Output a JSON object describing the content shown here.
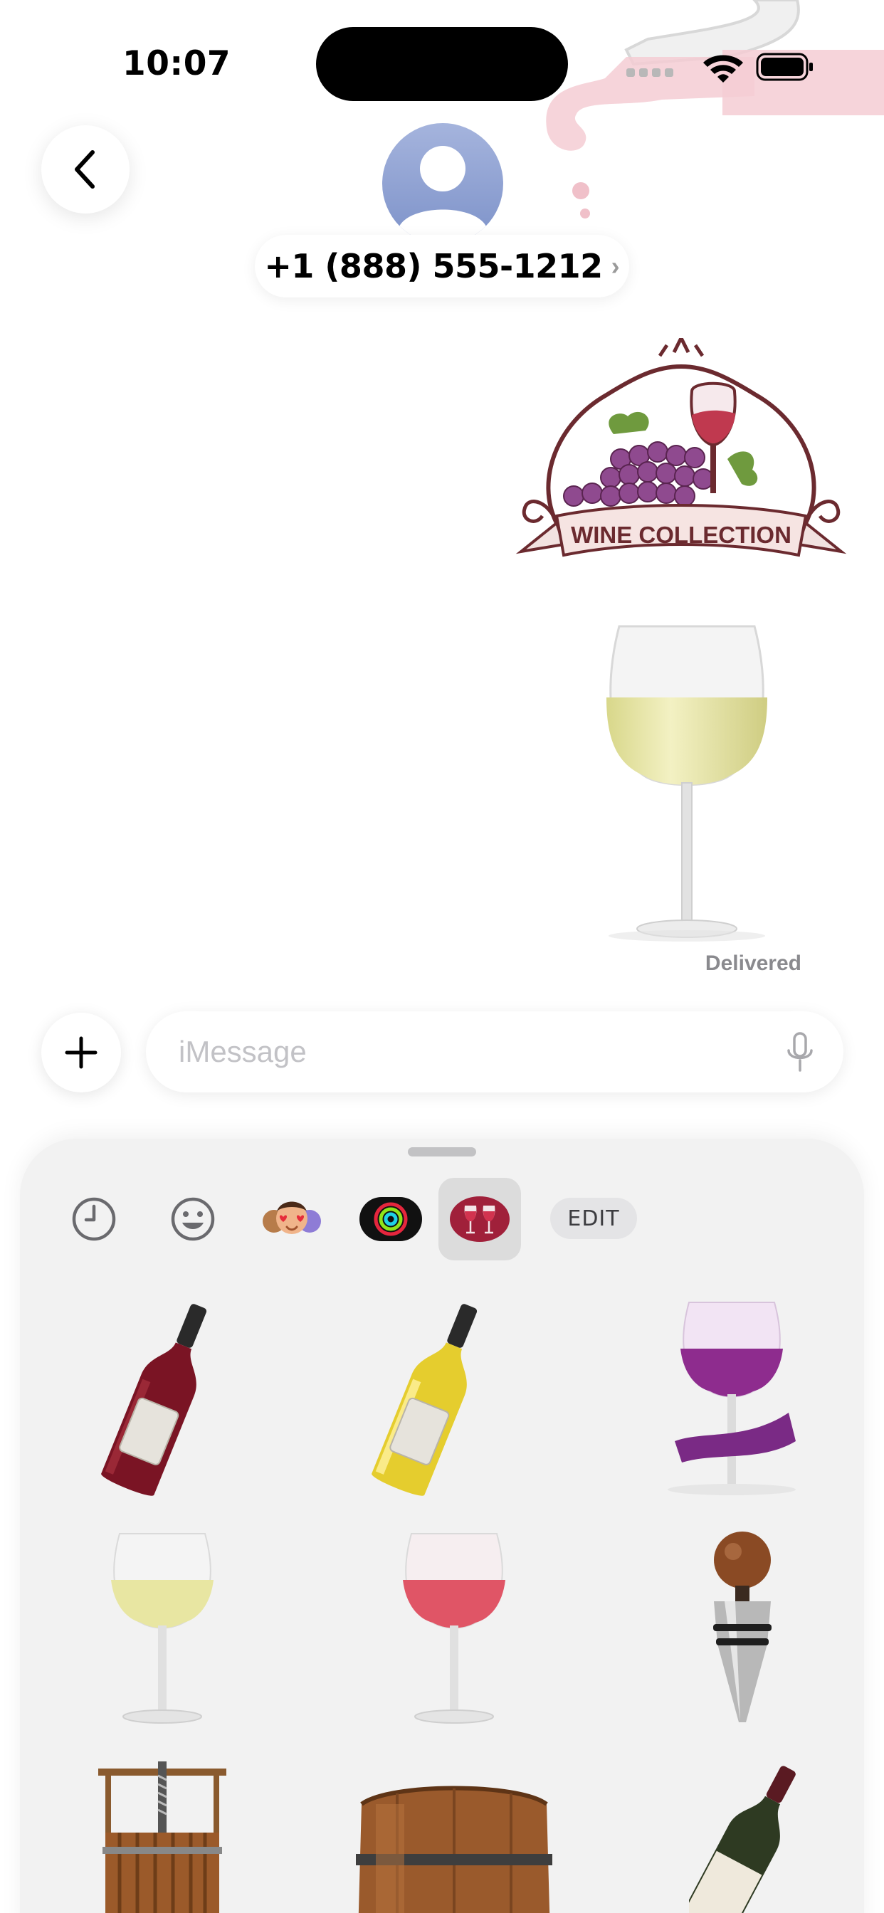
{
  "status_bar": {
    "time": "10:07"
  },
  "header": {
    "back_icon": "chevron-left-icon",
    "avatar_icon": "person-icon",
    "contact_number": "+1 (888) 555-1212",
    "contact_chevron": "›"
  },
  "conversation": {
    "stickers": [
      {
        "name": "wine-collection-logo-sticker",
        "text": "WINE COLLECTION"
      },
      {
        "name": "white-wine-glass-sticker"
      }
    ],
    "delivery_status": "Delivered"
  },
  "composer": {
    "placeholder": "iMessage",
    "plus_icon": "plus-icon",
    "mic_icon": "microphone-icon"
  },
  "drawer": {
    "tabs": [
      {
        "name": "recents",
        "icon": "clock-icon"
      },
      {
        "name": "emoji",
        "icon": "smiley-icon"
      },
      {
        "name": "memoji",
        "icon": "memoji-icon"
      },
      {
        "name": "activity",
        "icon": "activity-rings-icon"
      },
      {
        "name": "wine-stickers",
        "icon": "wine-glasses-icon",
        "selected": true
      }
    ],
    "edit_label": "EDIT",
    "stickers": [
      "red-wine-bottle",
      "white-wine-bottle",
      "purple-wine-glass-with-ribbon",
      "white-wine-glass",
      "rose-wine-glass",
      "wine-bottle-stopper",
      "wine-press",
      "wine-barrel",
      "dark-wine-bottle"
    ]
  },
  "colors": {
    "accent_blue": "#7d92c9",
    "wine_red": "#8a1a2c",
    "drawer_background": "#f2f2f2",
    "secondary_text": "#8a8a8e"
  }
}
